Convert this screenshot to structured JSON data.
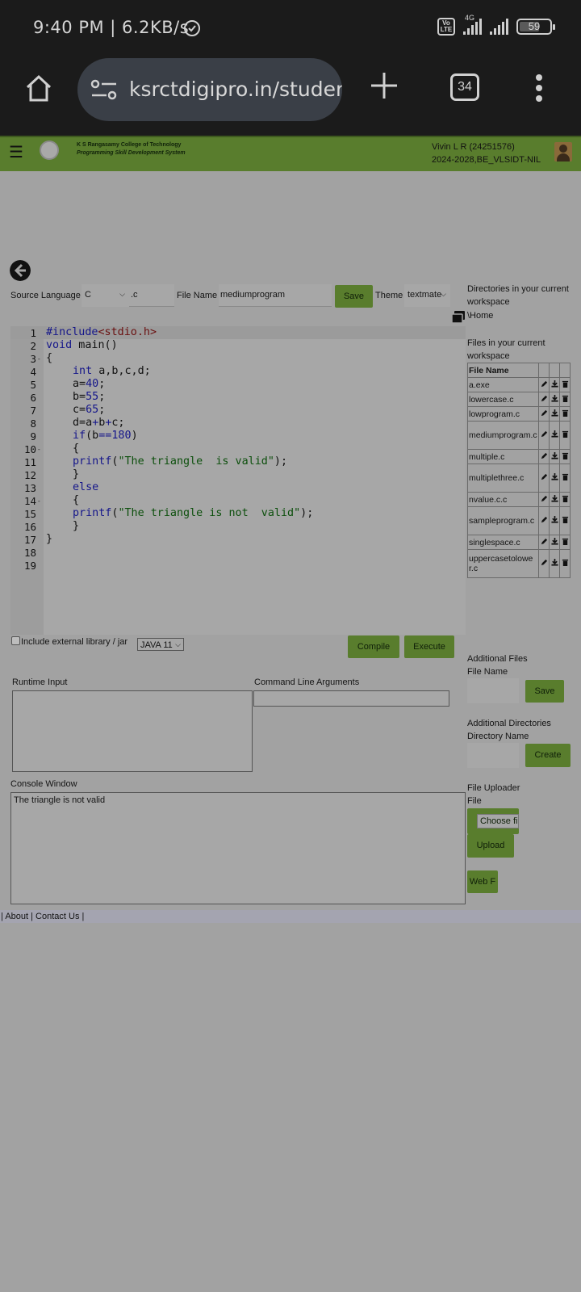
{
  "status_bar": {
    "time": "9:40 PM | 6.2KB/s",
    "network": "4G",
    "volte": "Vo LTE",
    "battery": "59"
  },
  "browser": {
    "url": "ksrctdigipro.in/studer",
    "tab_count": "34"
  },
  "site_header": {
    "college_name": "K S Rangasamy College of Technology",
    "college_sub": "Programming Skill Development System",
    "user_name": "Vivin L R (24251576)",
    "user_batch": "2024-2028,BE_VLSIDT-NIL"
  },
  "controls": {
    "source_language_label": "Source Language",
    "source_language_value": "C",
    "extension": ".c",
    "file_name_label": "File Name",
    "file_name_value": "mediumprogram",
    "save_label": "Save",
    "theme_label": "Theme",
    "theme_value": "textmate"
  },
  "editor": {
    "lines": [
      {
        "n": "1",
        "fold": ""
      },
      {
        "n": "2",
        "fold": ""
      },
      {
        "n": "3",
        "fold": "-"
      },
      {
        "n": "4",
        "fold": ""
      },
      {
        "n": "5",
        "fold": ""
      },
      {
        "n": "6",
        "fold": ""
      },
      {
        "n": "7",
        "fold": ""
      },
      {
        "n": "8",
        "fold": ""
      },
      {
        "n": "9",
        "fold": ""
      },
      {
        "n": "10",
        "fold": "-"
      },
      {
        "n": "11",
        "fold": ""
      },
      {
        "n": "12",
        "fold": ""
      },
      {
        "n": "13",
        "fold": ""
      },
      {
        "n": "14",
        "fold": "-"
      },
      {
        "n": "15",
        "fold": ""
      },
      {
        "n": "16",
        "fold": ""
      },
      {
        "n": "17",
        "fold": ""
      },
      {
        "n": "18",
        "fold": ""
      },
      {
        "n": "19",
        "fold": ""
      }
    ],
    "code": {
      "l1_pp": "#include",
      "l1_inc": "<stdio.h>",
      "l2_kw": "void",
      "l2_rest": " main()",
      "l3": "{",
      "l4_kw": "int",
      "l4_rest": " a,b,c,d;",
      "l5_a": "a=",
      "l5_n": "40",
      "l5_e": ";",
      "l6_a": "b=",
      "l6_n": "55",
      "l6_e": ";",
      "l7_a": "c=",
      "l7_n": "65",
      "l7_e": ";",
      "l8_a": "d=a",
      "l8_p1": "+",
      "l8_b": "b",
      "l8_p2": "+",
      "l8_c": "c;",
      "l9_kw": "if",
      "l9_a": "(b",
      "l9_op": "==",
      "l9_n": "180",
      "l9_e": ")",
      "l10": "{",
      "l11_fn": "printf",
      "l11_a": "(",
      "l11_s": "\"The triangle  is valid\"",
      "l11_e": ");",
      "l12": "}",
      "l13_kw": "else",
      "l14": "{",
      "l15_fn": "printf",
      "l15_a": "(",
      "l15_s": "\"The triangle is not  valid\"",
      "l15_e": ");",
      "l16": "}",
      "l17": "}"
    }
  },
  "sidebar": {
    "dirs_title": "Directories in your current workspace",
    "home_dir": "\\Home",
    "files_title": "Files in your current workspace",
    "table_header": "File Name",
    "files": [
      "a.exe",
      "lowercase.c",
      "lowprogram.c",
      "mediumprogram.c",
      "multiple.c",
      "multiplethree.c",
      "nvalue.c.c",
      "sampleprogram.c",
      "singlespace.c",
      "uppercasetolower.c"
    ],
    "additional_files": "Additional Files",
    "file_name_label": "File Name",
    "save_label": "Save",
    "additional_dirs": "Additional Directories",
    "dir_name_label": "Directory Name",
    "create_label": "Create",
    "uploader": "File Uploader",
    "file_label": "File",
    "choose_file": "Choose fi",
    "upload_label": "Upload",
    "web_label": "Web F"
  },
  "run": {
    "include_lib": "Include external library / jar",
    "java_version": "JAVA 11",
    "compile": "Compile",
    "execute": "Execute",
    "runtime_input": "Runtime Input",
    "cmd_args": "Command Line Arguments",
    "console_window": "Console Window",
    "console_output": "The triangle is not  valid"
  },
  "footer": {
    "pipe1": "|",
    "about": "About",
    "pipe2": "|",
    "contact": "Contact Us",
    "pipe3": "|"
  },
  "colors": {
    "green": "#597d2d",
    "page_bg": "#a2a2a2",
    "dark": "#1b1b1b"
  }
}
